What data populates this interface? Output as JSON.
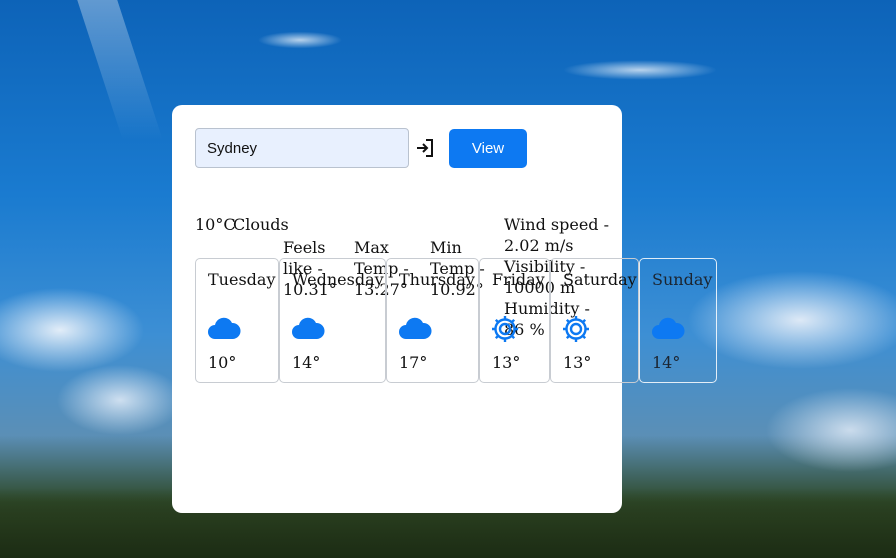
{
  "search": {
    "value": "Sydney"
  },
  "view_button": "View",
  "current": {
    "temp": "10°C",
    "description": "Clouds",
    "feels_like": "Feels like - 10.31°",
    "max_temp": "Max Temp - 13.27°",
    "min_temp": "Min Temp - 10.92°",
    "wind": "Wind speed - 2.02 m/s",
    "visibility": "Visibility - 10000 m",
    "humidity": "Humidity - 86 %"
  },
  "forecast": [
    {
      "day": "Tuesday",
      "icon": "cloud-icon",
      "temp": "10°"
    },
    {
      "day": "Wednesday",
      "icon": "cloud-icon",
      "temp": "14°"
    },
    {
      "day": "Thursday",
      "icon": "cloud-icon",
      "temp": "17°"
    },
    {
      "day": "Friday",
      "icon": "sun-icon",
      "temp": "13°"
    },
    {
      "day": "Saturday",
      "icon": "sun-icon",
      "temp": "13°"
    },
    {
      "day": "Sunday",
      "icon": "cloud-icon",
      "temp": "14°"
    }
  ],
  "colors": {
    "accent": "#0d79f2",
    "input_bg": "#e8f0fe"
  }
}
